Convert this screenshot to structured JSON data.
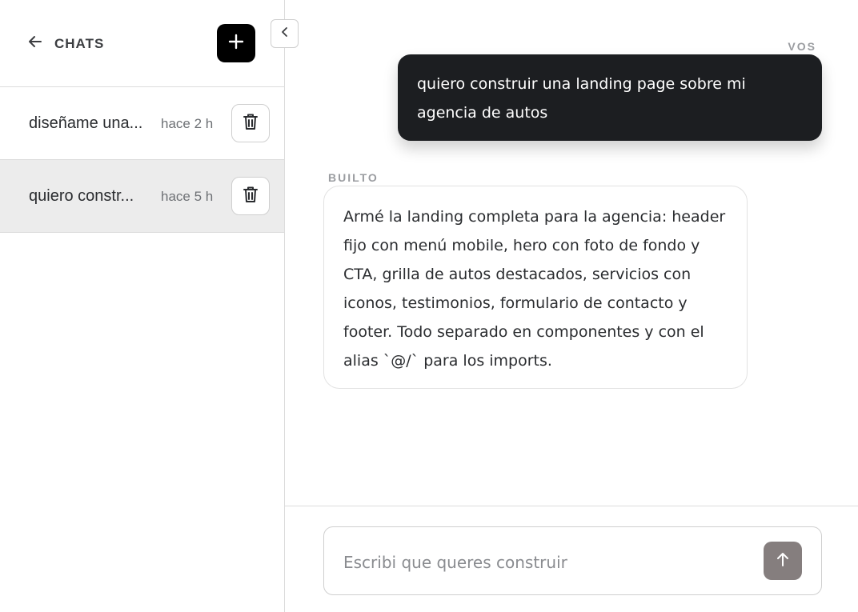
{
  "sidebar": {
    "title": "CHATS",
    "back_icon": "arrow-left-icon",
    "new_chat_icon": "plus-icon",
    "collapse_icon": "chevron-left-icon",
    "items": [
      {
        "title": "diseñame una...",
        "time": "hace 2 h",
        "active": false,
        "delete_icon": "trash-icon"
      },
      {
        "title": "quiero constr...",
        "time": "hace 5 h",
        "active": true,
        "delete_icon": "trash-icon"
      }
    ]
  },
  "conversation": {
    "messages": [
      {
        "sender": "VOS",
        "text": "quiero construir una landing page sobre mi agencia de autos"
      },
      {
        "sender": "BUILTO",
        "text": "Armé la landing completa para la agencia: header fijo con menú mobile, hero con foto de fondo y CTA, grilla de autos destacados, servicios con iconos, testimonios, formulario de contacto y footer. Todo separado en componentes y con el alias `@/` para los imports."
      }
    ]
  },
  "composer": {
    "placeholder": "Escribi que queres construir",
    "value": "",
    "send_icon": "arrow-up-icon"
  },
  "colors": {
    "user_bubble": "#1c1e21",
    "new_chat_button": "#000000",
    "send_button": "#857e7e",
    "active_item": "#ececec"
  }
}
